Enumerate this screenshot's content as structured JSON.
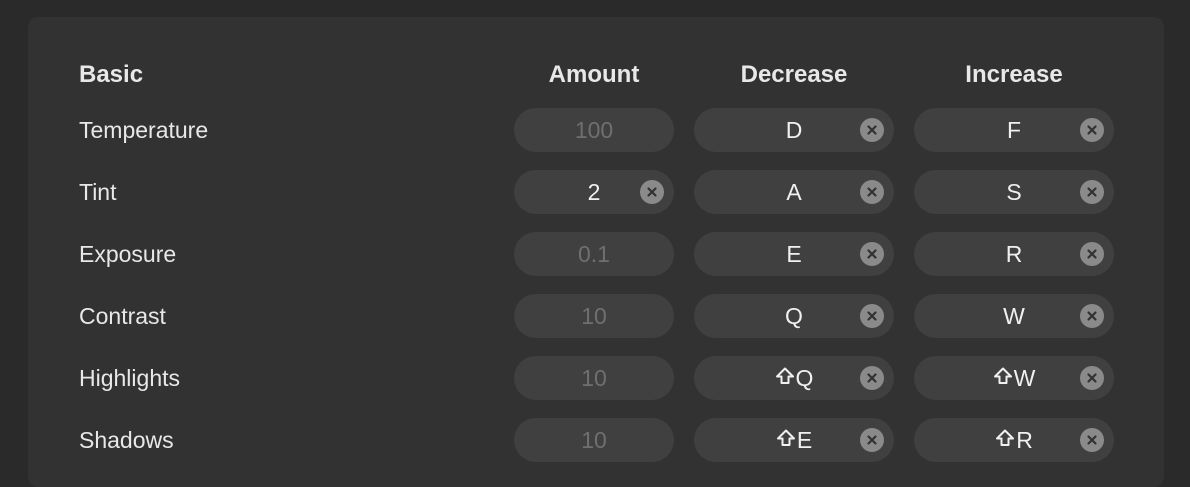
{
  "headers": {
    "section": "Basic",
    "amount": "Amount",
    "decrease": "Decrease",
    "increase": "Increase"
  },
  "colors": {
    "background": "#2a2a2a",
    "panel": "#323232",
    "field": "#404040",
    "placeholder_text": "#6f6f6f",
    "clear_button": "#8a8a8a"
  },
  "rows": [
    {
      "label": "Temperature",
      "amount": "100",
      "amount_is_placeholder": true,
      "decrease": "D",
      "decrease_shift": false,
      "increase": "F",
      "increase_shift": false
    },
    {
      "label": "Tint",
      "amount": "2",
      "amount_is_placeholder": false,
      "decrease": "A",
      "decrease_shift": false,
      "increase": "S",
      "increase_shift": false
    },
    {
      "label": "Exposure",
      "amount": "0.1",
      "amount_is_placeholder": true,
      "decrease": "E",
      "decrease_shift": false,
      "increase": "R",
      "increase_shift": false
    },
    {
      "label": "Contrast",
      "amount": "10",
      "amount_is_placeholder": true,
      "decrease": "Q",
      "decrease_shift": false,
      "increase": "W",
      "increase_shift": false
    },
    {
      "label": "Highlights",
      "amount": "10",
      "amount_is_placeholder": true,
      "decrease": "Q",
      "decrease_shift": true,
      "increase": "W",
      "increase_shift": true
    },
    {
      "label": "Shadows",
      "amount": "10",
      "amount_is_placeholder": true,
      "decrease": "E",
      "decrease_shift": true,
      "increase": "R",
      "increase_shift": true
    }
  ]
}
